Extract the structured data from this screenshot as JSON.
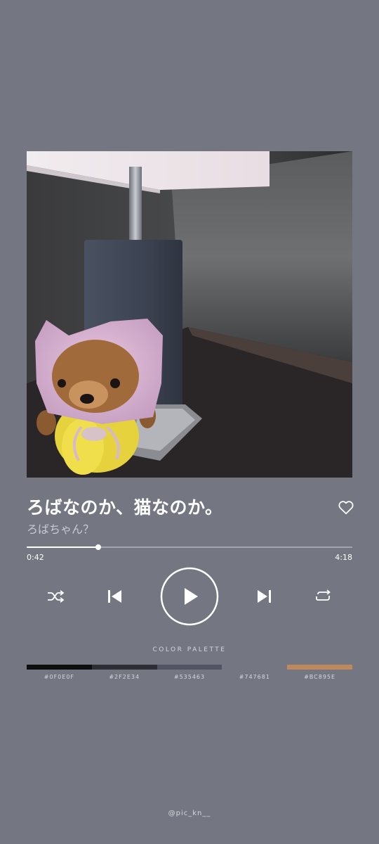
{
  "track": {
    "title": "ろばなのか、猫なのか。",
    "artist": "ろばちゃん？",
    "elapsed": "0:42",
    "total": "4:18",
    "progress_fraction": 0.22
  },
  "controls": {
    "shuffle_icon": "shuffle-icon",
    "previous_icon": "skip-previous-icon",
    "play_icon": "play-icon",
    "next_icon": "skip-next-icon",
    "repeat_icon": "repeat-icon",
    "like_icon": "heart-outline-icon"
  },
  "artwork": {
    "icon": "album-art-photo"
  },
  "palette": {
    "heading": "COLOR PALETTE",
    "swatches": [
      {
        "hex": "#0F0E0F",
        "label": "#0F0E0F"
      },
      {
        "hex": "#2F2E34",
        "label": "#2F2E34"
      },
      {
        "hex": "#535463",
        "label": "#535463"
      },
      {
        "hex": "#747681",
        "label": "#747681"
      },
      {
        "hex": "#BC895E",
        "label": "#BC895E"
      }
    ]
  },
  "footer": {
    "handle": "@pic_kn__"
  }
}
